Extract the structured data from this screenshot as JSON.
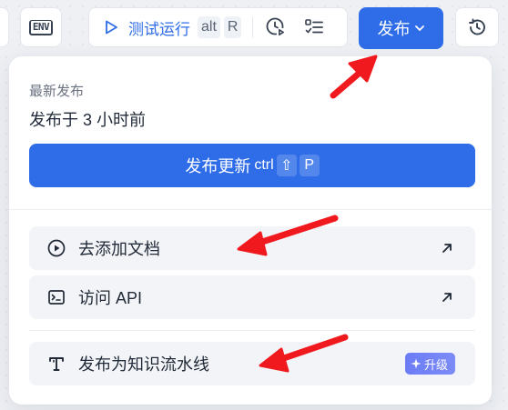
{
  "toolbar": {
    "env_label": "ENV",
    "run_label": "测试运行",
    "run_hotkey_1": "alt",
    "run_hotkey_2": "R",
    "publish_label": "发布"
  },
  "panel": {
    "section_label": "最新发布",
    "publish_time": "发布于 3 小时前",
    "update_label": "发布更新",
    "update_hotkey_1": "ctrl",
    "update_hotkey_2": "⇧",
    "update_hotkey_3": "P",
    "items": [
      {
        "label": "去添加文档",
        "icon": "play-circle-icon",
        "trailing": "external-arrow-icon"
      },
      {
        "label": "访问 API",
        "icon": "terminal-icon",
        "trailing": "external-arrow-icon"
      },
      {
        "label": "发布为知识流水线",
        "icon": "text-tool-icon",
        "badge": "升级"
      }
    ]
  },
  "colors": {
    "primary": "#2f6de8",
    "annotation_arrow": "#f0191e",
    "upgrade_badge": "#6d7cf5"
  }
}
